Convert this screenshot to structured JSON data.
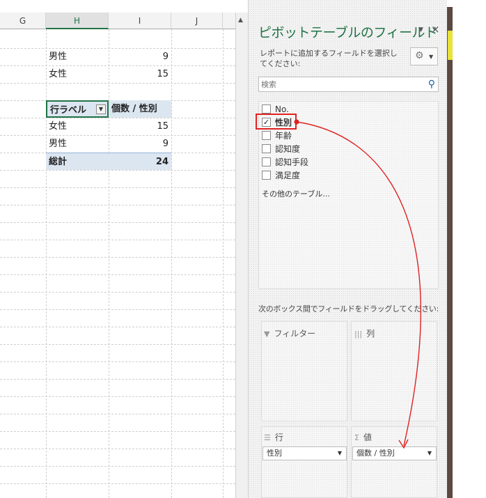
{
  "sheet": {
    "columns": [
      "G",
      "H",
      "I",
      "J"
    ],
    "source_rows": [
      {
        "label": "男性",
        "value": "9"
      },
      {
        "label": "女性",
        "value": "15"
      }
    ],
    "pivot": {
      "header_row_label": "行ラベル",
      "header_value": "個数 / 性別",
      "rows": [
        {
          "label": "女性",
          "value": "15"
        },
        {
          "label": "男性",
          "value": "9"
        }
      ],
      "total_label": "総計",
      "total_value": "24"
    }
  },
  "panel": {
    "title": "ピボットテーブルのフィールド",
    "caret_icon": "chevron-down-icon",
    "close_label": "×",
    "description": "レポートに追加するフィールドを選択してください:",
    "gear_icon": "gear-icon",
    "search_placeholder": "検索",
    "fields": [
      {
        "label": "No.",
        "checked": false
      },
      {
        "label": "性別",
        "checked": true
      },
      {
        "label": "年齢",
        "checked": false
      },
      {
        "label": "認知度",
        "checked": false
      },
      {
        "label": "認知手段",
        "checked": false
      },
      {
        "label": "満足度",
        "checked": false
      }
    ],
    "more_tables": "その他のテーブル...",
    "drag_hint": "次のボックス間でフィールドをドラッグしてください:",
    "areas": {
      "filter": {
        "label": "フィルター",
        "icon": "filter-icon"
      },
      "columns": {
        "label": "列",
        "icon": "columns-icon"
      },
      "rows": {
        "label": "行",
        "icon": "rows-icon",
        "item": "性別"
      },
      "values": {
        "label": "値",
        "icon": "sigma-icon",
        "item": "個数 / 性別"
      }
    }
  },
  "annotation_color": "#e02020"
}
